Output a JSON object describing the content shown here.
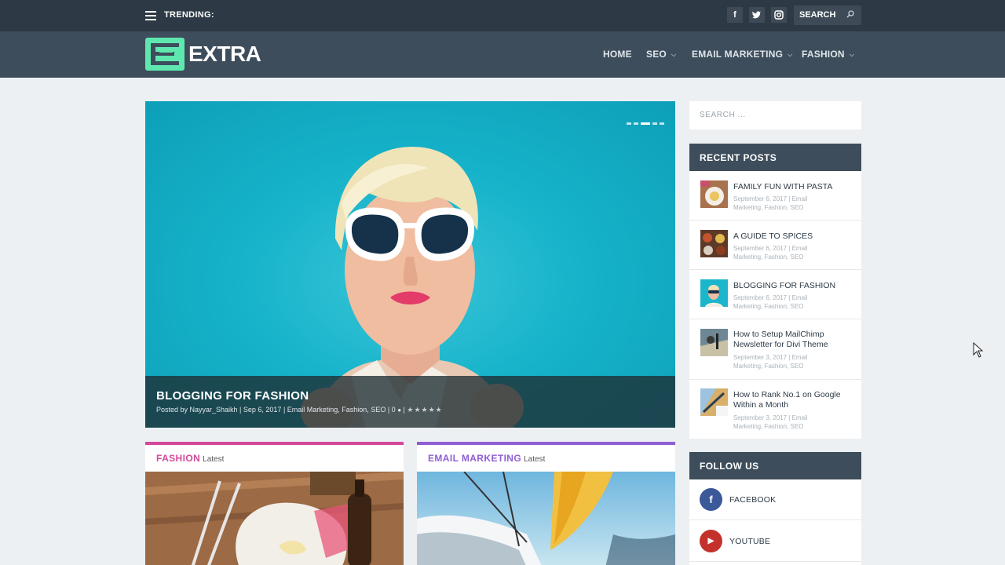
{
  "topbar": {
    "trending_label": "TRENDING:",
    "social": [
      {
        "icon": "facebook-icon",
        "glyph": "f"
      },
      {
        "icon": "twitter-icon",
        "glyph": "t"
      },
      {
        "icon": "instagram-icon",
        "glyph": "◙"
      }
    ],
    "search_label": "SEARCH"
  },
  "header": {
    "logo_text": "EXTRA",
    "nav": [
      {
        "label": "HOME",
        "dropdown": false
      },
      {
        "label": "SEO",
        "dropdown": true
      },
      {
        "label": "EMAIL MARKETING",
        "dropdown": true
      },
      {
        "label": "FASHION",
        "dropdown": true
      }
    ]
  },
  "hero": {
    "title": "BLOGGING FOR FASHION",
    "meta": "Posted by Nayyar_Shaikh | Sep 6, 2017 | Email Marketing, Fashion, SEO | 0",
    "stars": "★★★★★"
  },
  "categories": [
    {
      "title": "FASHION",
      "sub": "Latest",
      "color": "#d5489b"
    },
    {
      "title": "EMAIL MARKETING",
      "sub": "Latest",
      "color": "#8f5ed2"
    }
  ],
  "sidebar": {
    "search_placeholder": "SEARCH ...",
    "recent_posts_heading": "RECENT POSTS",
    "recent_posts": [
      {
        "title": "FAMILY FUN WITH PASTA",
        "meta": "September 6, 2017 | Email Marketing, Fashion, SEO"
      },
      {
        "title": "A GUIDE TO SPICES",
        "meta": "September 6, 2017 | Email Marketing, Fashion, SEO"
      },
      {
        "title": "BLOGGING FOR FASHION",
        "meta": "September 6, 2017 | Email Marketing, Fashion, SEO"
      },
      {
        "title": "How to Setup MailChimp Newsletter for Divi Theme",
        "meta": "September 3, 2017 | Email Marketing, Fashion, SEO"
      },
      {
        "title": "How to Rank No.1 on Google Within a Month",
        "meta": "September 3, 2017 | Email Marketing, Fashion, SEO"
      }
    ],
    "follow_heading": "FOLLOW US",
    "follow": [
      {
        "label": "FACEBOOK",
        "glyph": "f",
        "color": "#3b5998"
      },
      {
        "label": "YOUTUBE",
        "glyph": "▶",
        "color": "#c4302b"
      }
    ]
  },
  "colors": {
    "accent": "#5ee8b0",
    "header_bg": "#3d4d5b",
    "topbar_bg": "#2d3a45"
  }
}
